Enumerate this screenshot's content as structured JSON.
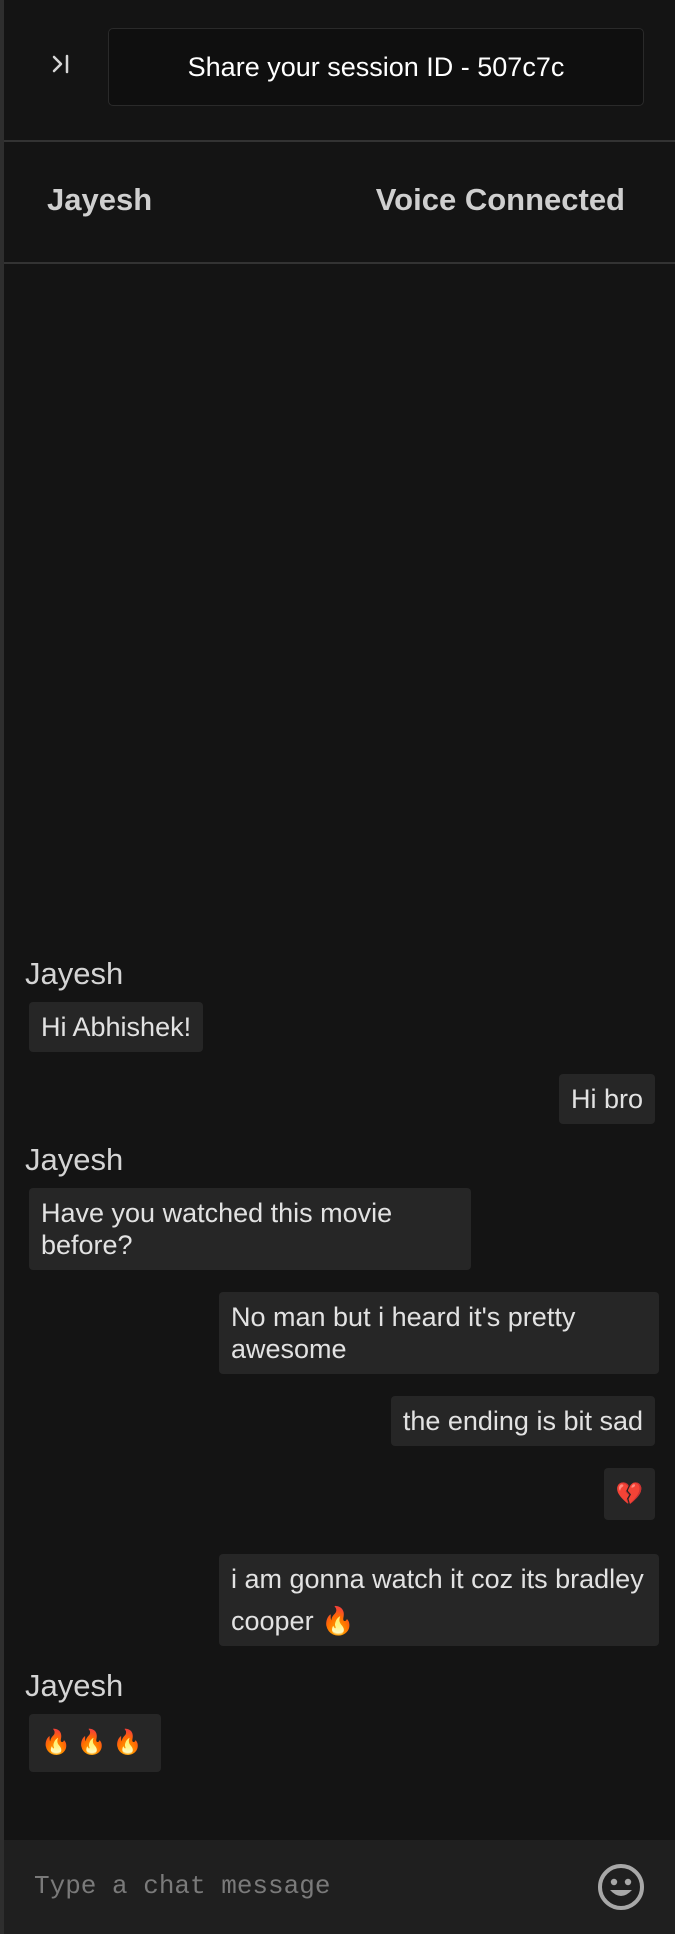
{
  "topbar": {
    "collapse_icon": "collapse-panel-icon",
    "collapse_glyph": ">|",
    "session_label": "Share your session ID - 507c7c"
  },
  "header": {
    "peer_name": "Jayesh",
    "voice_status": "Voice Connected"
  },
  "messages": [
    {
      "from": "peer",
      "sender": "Jayesh",
      "text": "Hi Abhishek!"
    },
    {
      "from": "me",
      "text": "Hi bro"
    },
    {
      "from": "peer",
      "sender": "Jayesh",
      "text": "Have you watched this movie before?"
    },
    {
      "from": "me",
      "text": "No man but i heard it's pretty awesome"
    },
    {
      "from": "me",
      "text": "the ending is bit sad"
    },
    {
      "from": "me",
      "text": "💔"
    },
    {
      "from": "me",
      "text": "i am gonna watch it coz its bradley cooper 🔥"
    },
    {
      "from": "peer",
      "sender": "Jayesh",
      "text": "🔥🔥🔥"
    }
  ],
  "composer": {
    "placeholder": "Type a chat message",
    "emoji_icon": "emoji-smile-icon"
  },
  "colors": {
    "background": "#141414",
    "bubble": "#262626",
    "input_bar": "#1f1f1f"
  }
}
